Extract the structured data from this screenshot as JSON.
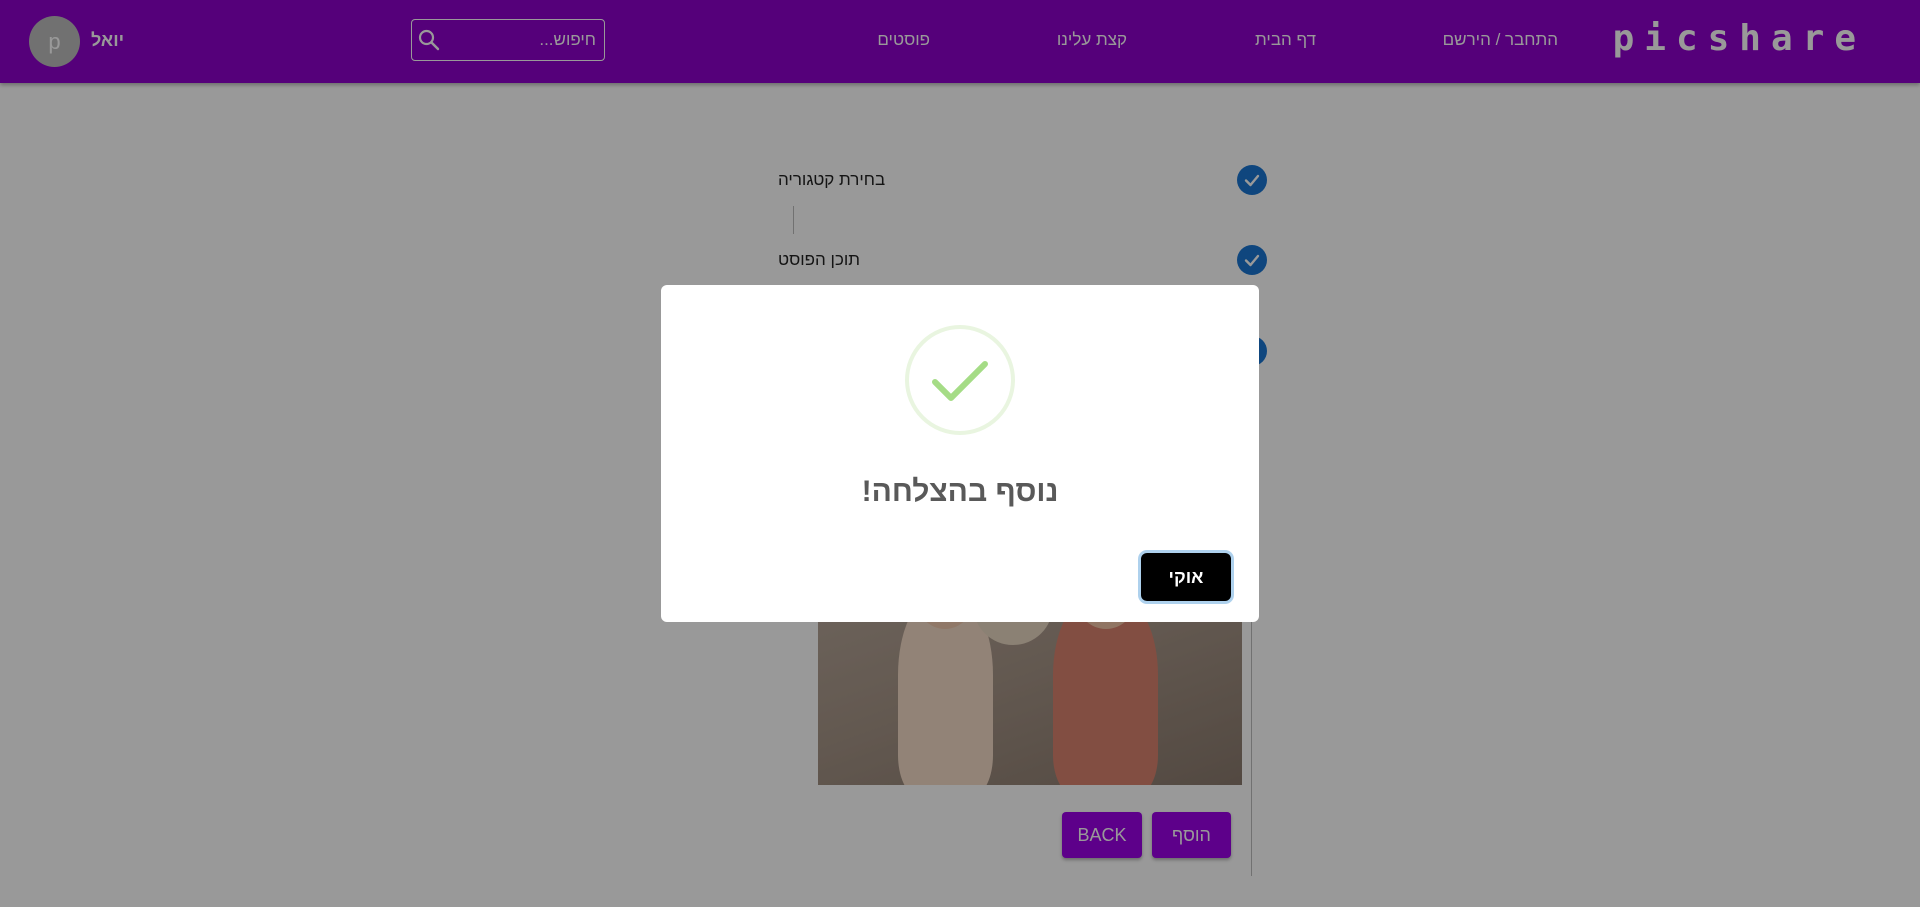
{
  "navbar": {
    "logo": "picshare",
    "links": {
      "login": "התחבר / הירשם",
      "home": "דף הבית",
      "about": "קצת עלינו",
      "posts": "פוסטים"
    },
    "search": {
      "placeholder": "חיפוש..."
    },
    "user": {
      "avatar_letter": "p",
      "name": "יואל"
    }
  },
  "stepper": {
    "steps": [
      {
        "label": "בחירת קטגוריה",
        "state": "completed"
      },
      {
        "label": "תוכן הפוסט",
        "state": "completed"
      }
    ]
  },
  "actions": {
    "back_label": "BACK",
    "add_label": "הוסף"
  },
  "modal": {
    "title": "נוסף בהצלחה!",
    "ok_label": "אוקי",
    "icon": "success-check-icon"
  },
  "colors": {
    "navbar": "#8e00cc",
    "button": "#9c00e6",
    "step_icon": "#1976d2",
    "success": "#a5dc86"
  }
}
